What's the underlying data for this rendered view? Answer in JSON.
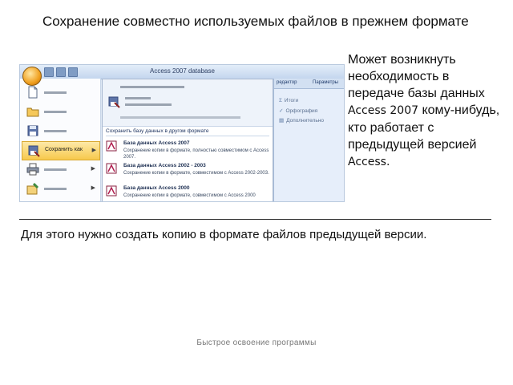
{
  "slide": {
    "title": "Сохранение совместно используемых файлов в прежнем формате",
    "side_text_1": "Может возникнуть необходимость в передаче базы данных ",
    "side_text_access2007": "Access 2007",
    "side_text_2": " кому-нибудь, кто работает с предыдущей версией ",
    "side_text_access": "Access",
    "side_text_end": ".",
    "caption": "Для этого нужно создать копию в формате файлов предыдущей версии.",
    "footer": "Быстрое освоение программы"
  },
  "screenshot": {
    "window_title": "Access 2007 database",
    "ribbon_tabs": [
      "редактор",
      "Параметры"
    ],
    "ribbon_items": [
      {
        "icon": "sigma-icon",
        "label": "Итоги"
      },
      {
        "icon": "spellcheck-icon",
        "label": "Орфография"
      },
      {
        "icon": "more-icon",
        "label": "Дополнительно"
      }
    ],
    "menu": {
      "active_label": "Сохранить как",
      "items": [
        {
          "icon": "new-document-icon"
        },
        {
          "icon": "open-folder-icon"
        },
        {
          "icon": "save-disk-icon"
        },
        {
          "icon": "save-as-icon"
        },
        {
          "icon": "print-icon"
        },
        {
          "icon": "manage-icon"
        }
      ]
    },
    "submenu": {
      "heading": "Сохранить базу данных в другом формате",
      "options": [
        {
          "icon": "access-2007-file-icon",
          "title": "База данных Access 2007",
          "desc": "Сохранение копии в формате, полностью совместимом с Access 2007."
        },
        {
          "icon": "access-2002-file-icon",
          "title": "База данных Access 2002 - 2003",
          "desc": "Сохранение копии в формате, совместимом с Access 2002-2003."
        },
        {
          "icon": "access-2000-file-icon",
          "title": "База данных Access 2000",
          "desc": "Сохранение копии в формате, совместимом с Access 2000"
        }
      ]
    },
    "colors": {
      "accent": "#f7c94c",
      "office_button": "#f0a020"
    }
  }
}
